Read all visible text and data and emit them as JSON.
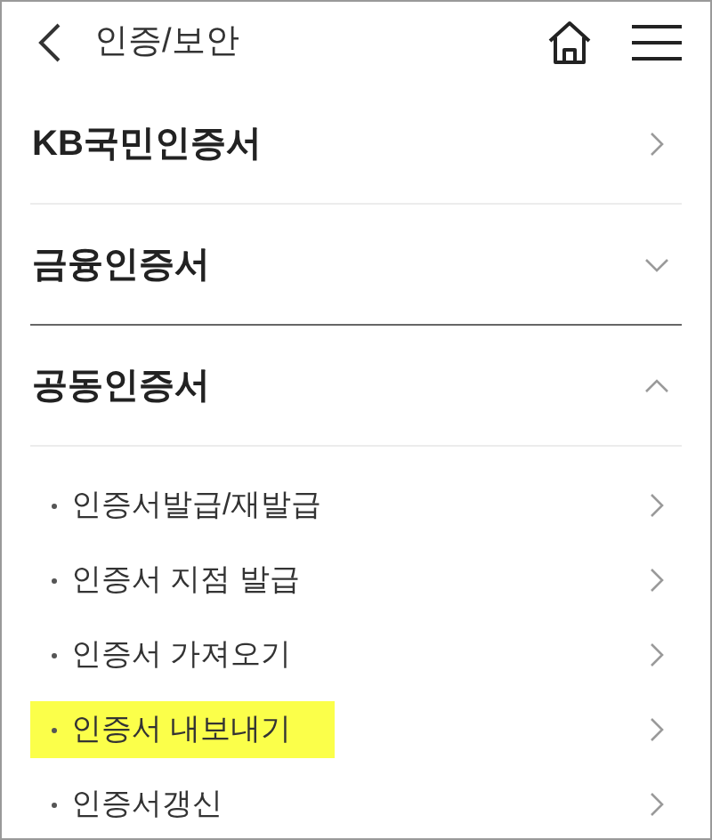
{
  "header": {
    "title": "인증/보안"
  },
  "sections": [
    {
      "kind": "link",
      "label": "KB국민인증서"
    },
    {
      "kind": "accordion",
      "label": "금융인증서",
      "expanded": false
    },
    {
      "kind": "accordion",
      "label": "공동인증서",
      "expanded": true,
      "children": [
        {
          "label": "인증서발급/재발급",
          "highlighted": false
        },
        {
          "label": "인증서 지점 발급",
          "highlighted": false
        },
        {
          "label": "인증서 가져오기",
          "highlighted": false
        },
        {
          "label": "인증서 내보내기",
          "highlighted": true
        },
        {
          "label": "인증서갱신",
          "highlighted": false
        }
      ]
    }
  ]
}
